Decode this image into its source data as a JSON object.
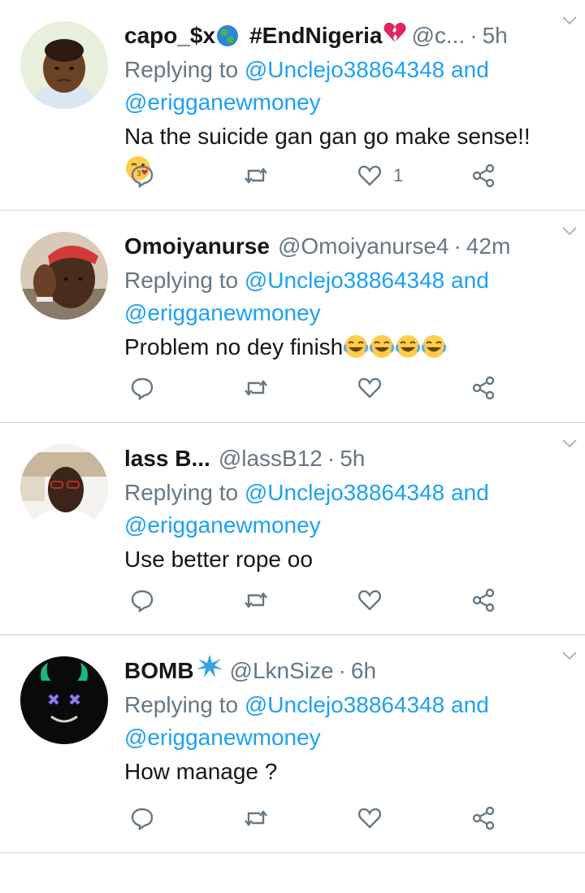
{
  "tweets": [
    {
      "name": "capo_$x",
      "name_suffix": "#EndNigeria",
      "handle": "@c...",
      "time": "5h",
      "replying_prefix": "Replying to",
      "reply_mention_1": "@Unclejo38864348",
      "reply_and": "and",
      "reply_mention_2": "@erigganewmoney",
      "text": "Na the suicide gan gan go make sense!!",
      "like_count": "1",
      "avatar": "child-photo"
    },
    {
      "name": "Omoiyanurse",
      "handle": "@Omoiyanurse4",
      "time": "42m",
      "replying_prefix": "Replying to",
      "reply_mention_1": "@Unclejo38864348",
      "reply_and": "and",
      "reply_mention_2": "@erigganewmoney",
      "text": "Problem no dey finish",
      "like_count": "",
      "avatar": "man-red-cap-photo"
    },
    {
      "name": "lass B...",
      "handle": "@lassB12",
      "time": "5h",
      "replying_prefix": "Replying to",
      "reply_mention_1": "@Unclejo38864348",
      "reply_and": "and",
      "reply_mention_2": "@erigganewmoney",
      "text": "Use better rope oo",
      "like_count": "",
      "avatar": "man-glasses-photo"
    },
    {
      "name": "BOMB",
      "handle": "@LknSize",
      "time": "6h",
      "replying_prefix": "Replying to",
      "reply_mention_1": "@Unclejo38864348",
      "reply_and": "and",
      "reply_mention_2": "@erigganewmoney",
      "text": "How manage ?",
      "like_count": "",
      "avatar": "dark-face-logo"
    }
  ],
  "separator": "·",
  "icons": [
    "reply-icon",
    "retweet-icon",
    "like-icon",
    "share-icon",
    "chevron-down-icon"
  ],
  "colors": {
    "link": "#1da1f2",
    "muted": "#657786",
    "text": "#14171a",
    "divider": "#cfd6dc"
  }
}
